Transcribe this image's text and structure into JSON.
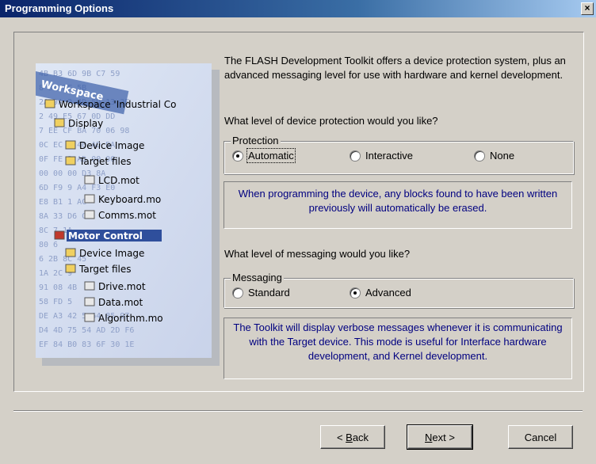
{
  "window": {
    "title": "Programming Options",
    "close_label": "×"
  },
  "intro": "The FLASH Development Toolkit offers a device protection system, plus an advanced messaging level for use with hardware and kernel development.",
  "protection": {
    "question": "What level of device protection would you like?",
    "group_label": "Protection",
    "options": [
      "Automatic",
      "Interactive",
      "None"
    ],
    "selected": "Automatic",
    "info": "When programming the device, any blocks found to have been written previously will automatically be erased."
  },
  "messaging": {
    "question": "What level of messaging would you like?",
    "group_label": "Messaging",
    "options": [
      "Standard",
      "Advanced"
    ],
    "selected": "Advanced",
    "info": "The Toolkit will display verbose messages whenever it is communicating with the Target device. This mode is useful for Interface hardware development, and Kernel development."
  },
  "illustration": {
    "header": "Workspace",
    "items": [
      "Workspace 'Industrial Co",
      "Display",
      "Device Image",
      "Target files",
      "LCD.mot",
      "Keyboard.mo",
      "Comms.mot",
      "Motor Control",
      "Device Image",
      "Target files",
      "Drive.mot",
      "Data.mot",
      "Algorithm.mo"
    ],
    "hex_rows": [
      "4B B3 6D 9B C7 59",
      "8 DA FF 5B",
      "2A 9A 2 4D 5D 13 3E",
      "2 49 E5 67 0D DD",
      "7 EE CF BA 70 06 98",
      "0C EC 8 40 AD BA",
      "0F FE 2 AD 00 00",
      "00 00 00 D3 8A",
      "6D F9 9 A4 F3 E0",
      "E8 B1 1 AC",
      "8A 33 D6 C1",
      "8C 7 1A",
      "80 6",
      "6 2B 8C 45",
      "1A 2C 9",
      "91 08 4B",
      "58 FD 5",
      "DE A3 42 5 64 85 97",
      "D4 4D 75 54 AD 2D F6",
      "EF 84 B0 83 6F 30 1E"
    ]
  },
  "buttons": {
    "back": "Back",
    "back_key": "B",
    "next": "Next",
    "next_key": "N",
    "cancel": "Cancel"
  }
}
